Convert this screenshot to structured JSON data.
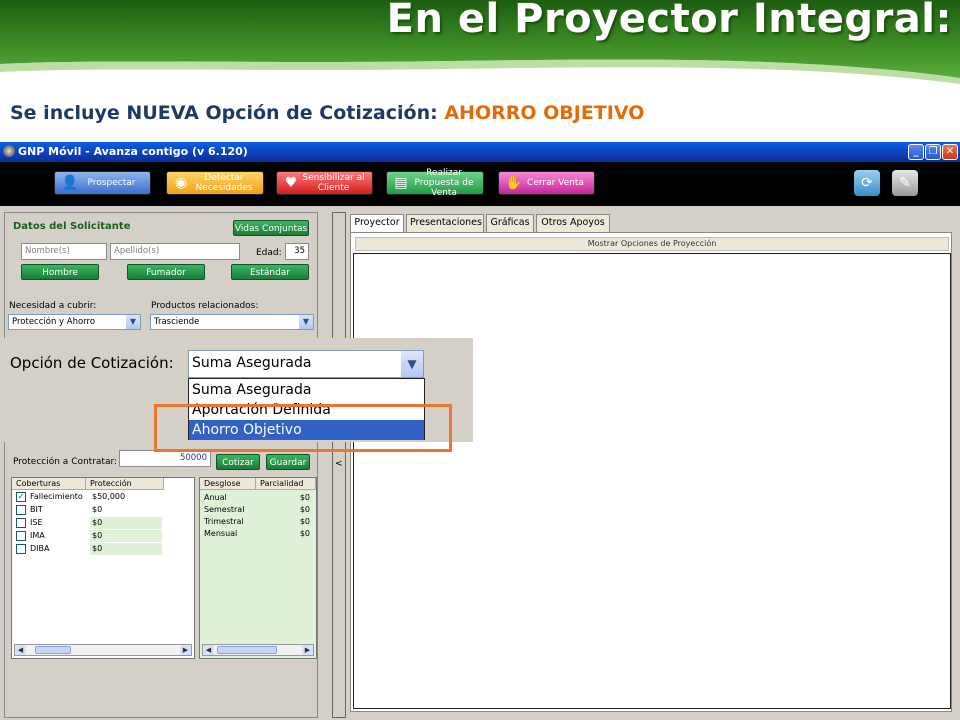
{
  "slide": {
    "title": "En el Proyector Integral:",
    "subtitle_prefix": "Se incluye NUEVA Opción de Cotización:",
    "subtitle_highlight": "AHORRO OBJETIVO"
  },
  "window": {
    "title": "GNP Móvil - Avanza contigo (v 6.120)",
    "controls": [
      "_",
      "❐",
      "✕"
    ]
  },
  "toolbar": {
    "buttons": [
      "Prospectar",
      "Detectar Necesidades",
      "Sensibilizar al Cliente",
      "Realizar Propuesta de Venta",
      "Cerrar Venta"
    ]
  },
  "solicitante": {
    "heading": "Datos del Solicitante",
    "vidas_conjuntas": "Vidas Conjuntas",
    "nombre_placeholder": "Nombre(s)",
    "apellido_placeholder": "Apellido(s)",
    "edad_label": "Edad:",
    "edad_value": "35",
    "hombre": "Hombre",
    "fumador": "Fumador",
    "estandar": "Estándar",
    "necesidad_label": "Necesidad a cubrir:",
    "necesidad_value": "Protección y Ahorro",
    "productos_label": "Productos relacionados:",
    "productos_value": "Trasciende"
  },
  "contratar": {
    "label": "Protección a Contratar:",
    "value": "50000",
    "cotizar": "Cotizar",
    "guardar": "Guardar"
  },
  "coberturas": {
    "headers": [
      "Coberturas",
      "Protección"
    ],
    "rows": [
      {
        "name": "Fallecimiento",
        "value": "$50,000",
        "checked": "✓"
      },
      {
        "name": "BIT",
        "value": "$0",
        "checked": ""
      },
      {
        "name": "ISE",
        "value": "$0",
        "checked": ""
      },
      {
        "name": "IMA",
        "value": "$0",
        "checked": ""
      },
      {
        "name": "DIBA",
        "value": "$0",
        "checked": ""
      }
    ]
  },
  "desglose": {
    "headers": [
      "Desglose",
      "Parcialidad"
    ],
    "rows": [
      {
        "name": "Anual",
        "value": "$0"
      },
      {
        "name": "Semestral",
        "value": "$0"
      },
      {
        "name": "Trimestral",
        "value": "$0"
      },
      {
        "name": "Mensual",
        "value": "$0"
      }
    ]
  },
  "tabs": [
    "Proyector",
    "Presentaciones",
    "Gráficas",
    "Otros Apoyos"
  ],
  "mostrar_opciones": "Mostrar Opciones de Proyección",
  "splitter_arrow": "<",
  "cotizacion": {
    "label": "Opción de Cotización:",
    "selected": "Suma Asegurada",
    "options": [
      "Suma Asegurada",
      "Aportación Definida",
      "Ahorro Objetivo"
    ]
  },
  "colors": {
    "highlight": "#e8782f",
    "subtitle_accent": "#e36c0a",
    "selected_option": "#3162c5"
  }
}
